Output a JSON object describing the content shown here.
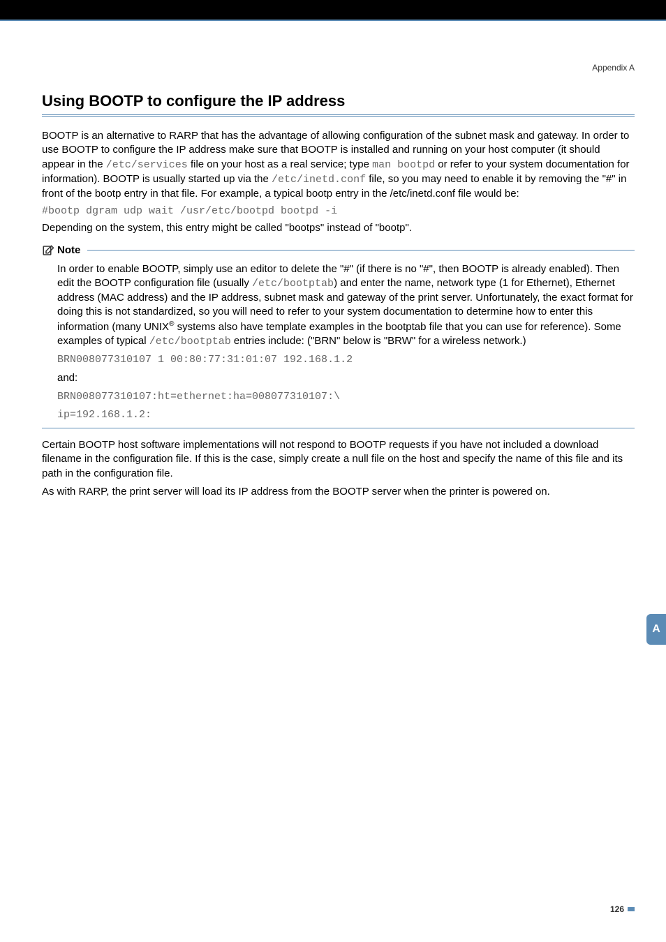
{
  "appendix": "Appendix A",
  "heading": "Using BOOTP to configure the IP address",
  "para1_pre": "BOOTP is an alternative to RARP that has the advantage of allowing configuration of the subnet mask and gateway. In order to use BOOTP to configure the IP address make sure that BOOTP is installed and running on your host computer (it should appear in the ",
  "mono1": "/etc/services",
  "para1_mid1": " file on your host as a real service; type ",
  "mono2": "man bootpd",
  "para1_mid2": " or refer to your system documentation for information). BOOTP is usually started up via the ",
  "mono3": "/etc/inetd.conf",
  "para1_end": " file, so you may need to enable it by removing the \"#\" in front of the bootp entry in that file. For example, a typical bootp entry in the /etc/inetd.conf file would be:",
  "code1": "#bootp dgram udp wait /usr/etc/bootpd bootpd -i",
  "para2": "Depending on the system, this entry might be called \"bootps\" instead of \"bootp\".",
  "note_label": "Note",
  "note_p1_pre": "In order to enable BOOTP, simply use an editor to delete the \"#\" (if there is no \"#\", then BOOTP is already enabled). Then edit the BOOTP configuration file (usually ",
  "note_mono1": "/etc/bootptab",
  "note_p1_end": ") and enter the name, network type (1 for Ethernet), Ethernet address (MAC address) and the IP address, subnet mask and gateway of the print server. Unfortunately, the exact format for doing this is not standardized, so you will need to refer to your system documentation to determine how to enter this information (many UNIX",
  "note_sup": "®",
  "note_p1_tail": " systems also have template examples in the bootptab file that you can use for reference). Some examples of typical ",
  "note_mono2": "/etc/bootptab",
  "note_p1_final": " entries include: (\"BRN\" below is \"BRW\" for a wireless network.)",
  "note_code1": "BRN008077310107 1  00:80:77:31:01:07 192.168.1.2",
  "note_and": "and:",
  "note_code2": "BRN008077310107:ht=ethernet:ha=008077310107:\\",
  "note_code3": "ip=192.168.1.2:",
  "para3": "Certain BOOTP host software implementations will not respond to BOOTP requests if you have not included a download filename in the configuration file. If this is the case, simply create a null file on the host and specify the name of this file and its path in the configuration file.",
  "para4": "As with RARP, the print server will load its IP address from the BOOTP server when the printer is powered on.",
  "tab": "A",
  "page": "126"
}
